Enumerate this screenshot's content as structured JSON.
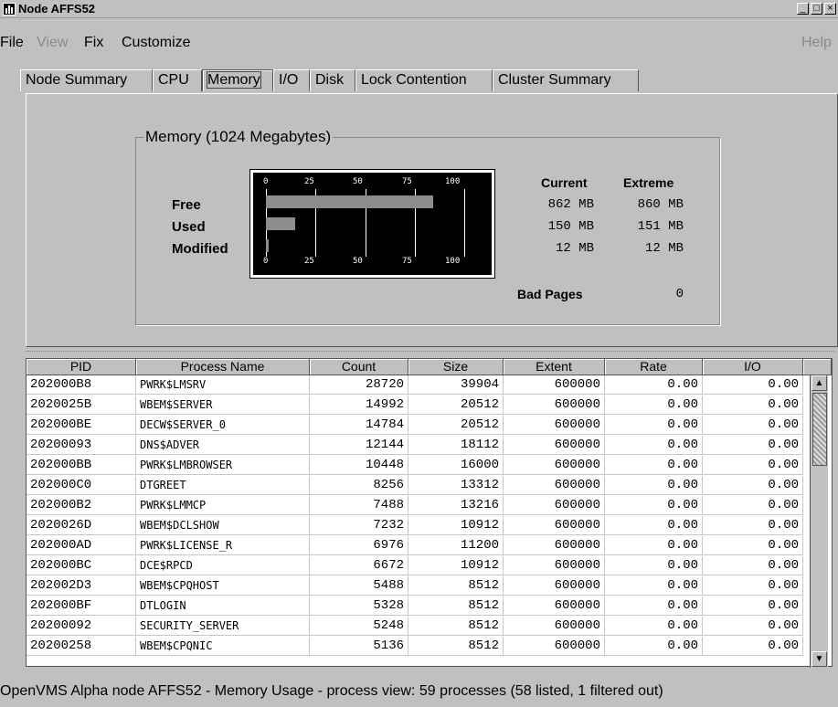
{
  "window": {
    "title": "Node AFFS52"
  },
  "menu": {
    "file": "File",
    "view": "View",
    "fix": "Fix",
    "customize": "Customize",
    "help": "Help"
  },
  "tabs": [
    "Node Summary",
    "CPU",
    "Memory",
    "I/O",
    "Disk",
    "Lock Contention",
    "Cluster Summary"
  ],
  "active_tab": "Memory",
  "memory": {
    "group_title": "Memory (1024 Megabytes)",
    "rows": [
      "Free",
      "Used",
      "Modified"
    ],
    "scale_labels": [
      "0",
      "25",
      "50",
      "75",
      "100"
    ],
    "bar_percent": {
      "free": 84.2,
      "used": 14.6,
      "modified": 1.2
    },
    "col_current": "Current",
    "col_extreme": "Extreme",
    "current": [
      "862 MB",
      "150 MB",
      "12 MB"
    ],
    "extreme": [
      "860 MB",
      "151 MB",
      "12 MB"
    ],
    "bad_pages_label": "Bad Pages",
    "bad_pages_value": "0"
  },
  "table": {
    "headers": [
      "PID",
      "Process Name",
      "Count",
      "Size",
      "Extent",
      "Rate",
      "I/O"
    ],
    "rows": [
      [
        "202000B8",
        "PWRK$LMSRV",
        "28720",
        "39904",
        "600000",
        "0.00",
        "0.00"
      ],
      [
        "2020025B",
        "WBEM$SERVER",
        "14992",
        "20512",
        "600000",
        "0.00",
        "0.00"
      ],
      [
        "202000BE",
        "DECW$SERVER_0",
        "14784",
        "20512",
        "600000",
        "0.00",
        "0.00"
      ],
      [
        "20200093",
        "DNS$ADVER",
        "12144",
        "18112",
        "600000",
        "0.00",
        "0.00"
      ],
      [
        "202000BB",
        "PWRK$LMBROWSER",
        "10448",
        "16000",
        "600000",
        "0.00",
        "0.00"
      ],
      [
        "202000C0",
        "DTGREET",
        "8256",
        "13312",
        "600000",
        "0.00",
        "0.00"
      ],
      [
        "202000B2",
        "PWRK$LMMCP",
        "7488",
        "13216",
        "600000",
        "0.00",
        "0.00"
      ],
      [
        "2020026D",
        "WBEM$DCLSHOW",
        "7232",
        "10912",
        "600000",
        "0.00",
        "0.00"
      ],
      [
        "202000AD",
        "PWRK$LICENSE_R",
        "6976",
        "11200",
        "600000",
        "0.00",
        "0.00"
      ],
      [
        "202000BC",
        "DCE$RPCD",
        "6672",
        "10912",
        "600000",
        "0.00",
        "0.00"
      ],
      [
        "202002D3",
        "WBEM$CPQHOST",
        "5488",
        "8512",
        "600000",
        "0.00",
        "0.00"
      ],
      [
        "202000BF",
        "DTLOGIN",
        "5328",
        "8512",
        "600000",
        "0.00",
        "0.00"
      ],
      [
        "20200092",
        "SECURITY_SERVER",
        "5248",
        "8512",
        "600000",
        "0.00",
        "0.00"
      ],
      [
        "20200258",
        "WBEM$CPQNIC",
        "5136",
        "8512",
        "600000",
        "0.00",
        "0.00"
      ]
    ]
  },
  "status": "OpenVMS Alpha node AFFS52 - Memory Usage - process view:  59 processes (58 listed, 1 filtered out)"
}
